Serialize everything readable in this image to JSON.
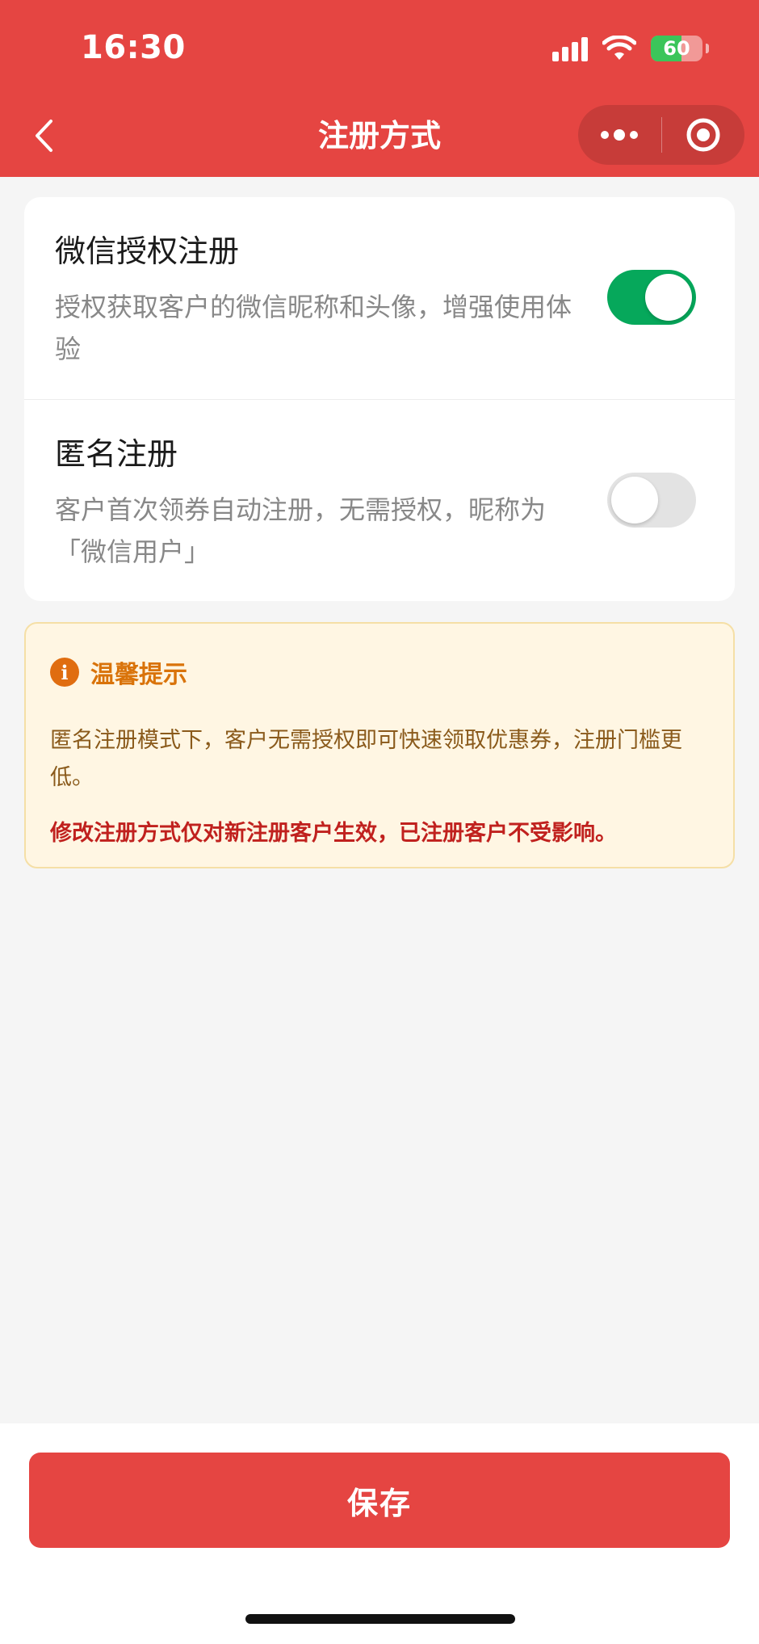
{
  "status_bar": {
    "time": "16:30",
    "battery": "60",
    "battery_level": 0.6
  },
  "nav": {
    "title": "注册方式",
    "back_icon": "chevron-left-icon",
    "more_icon": "more-dots-icon",
    "close_icon": "target-circle-icon"
  },
  "options": [
    {
      "title": "微信授权注册",
      "desc": "授权获取客户的微信昵称和头像，增强使用体验",
      "enabled": true
    },
    {
      "title": "匿名注册",
      "desc": "客户首次领券自动注册，无需授权，昵称为「微信用户」",
      "enabled": false
    }
  ],
  "tips": {
    "icon": "info-icon",
    "icon_glyph": "i",
    "title": "温馨提示",
    "text": "匿名注册模式下，客户无需授权即可快速领取优惠券，注册门槛更低。",
    "warning": "修改注册方式仅对新注册客户生效，已注册客户不受影响。"
  },
  "footer": {
    "save_label": "保存"
  },
  "colors": {
    "brand": "#e54542",
    "toggle_on": "#06a85b",
    "toggle_off": "#e3e3e3",
    "tips_bg": "#fff6e3",
    "tips_accent": "#d9730a",
    "warning": "#c0211e"
  }
}
